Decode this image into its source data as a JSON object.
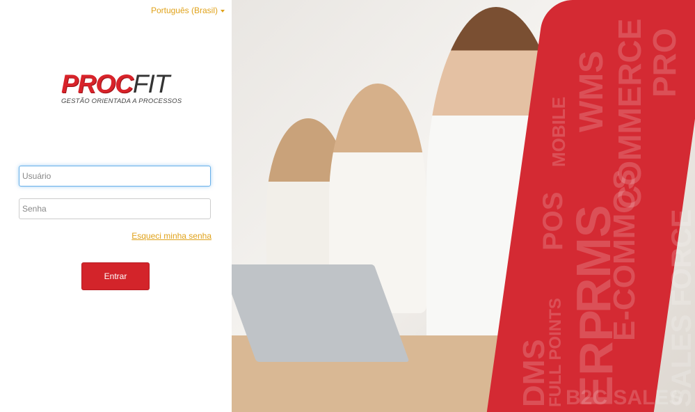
{
  "language": {
    "label": "Português (Brasil)"
  },
  "logo": {
    "brand_a": "PROC",
    "brand_b": "FIT",
    "tagline": "GESTÃO ORIENTADA A PROCESSOS"
  },
  "login": {
    "username_placeholder": "Usuário",
    "password_placeholder": "Senha",
    "forgot_label": "Esqueci minha senha",
    "submit_label": "Entrar"
  },
  "banner": {
    "words": [
      "WMS",
      "COMMERCE",
      "PRO",
      "MOBILE",
      "DMS",
      "POS",
      "RMS",
      "E-COMMOS",
      "SALES FORCE",
      "FULL POINTS",
      "ERP",
      "B2C SALES"
    ]
  }
}
